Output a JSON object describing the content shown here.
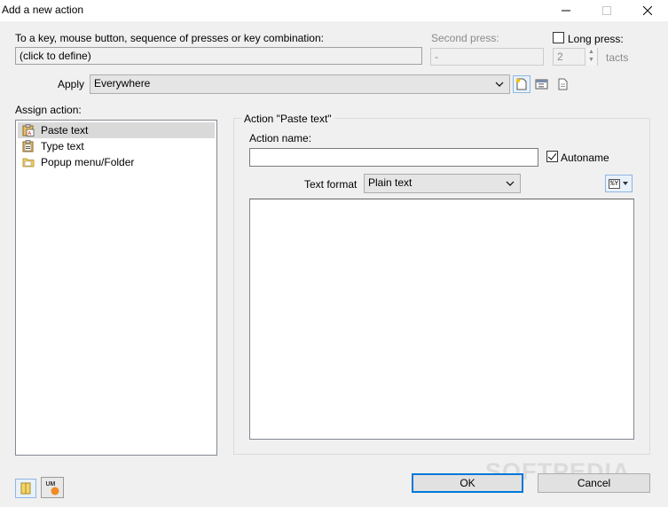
{
  "window": {
    "title": "Add a new action"
  },
  "trigger": {
    "label": "To a key, mouse button, sequence of presses or key combination:",
    "value": "(click to define)",
    "second_press_label": "Second press:",
    "second_press_value": "-",
    "long_press_label": "Long press:",
    "long_press_checked": false,
    "tacts_value": "2",
    "tacts_label": "tacts"
  },
  "apply": {
    "label": "Apply",
    "selected": "Everywhere"
  },
  "assign": {
    "label": "Assign action:",
    "items": [
      {
        "label": "Paste text",
        "icon": "paste-text-icon",
        "selected": true
      },
      {
        "label": "Type text",
        "icon": "type-text-icon",
        "selected": false
      },
      {
        "label": "Popup menu/Folder",
        "icon": "folder-icon",
        "selected": false
      }
    ]
  },
  "action_panel": {
    "group_title": "Action \"Paste text\"",
    "name_label": "Action name:",
    "name_value": "",
    "autoname_label": "Autoname",
    "autoname_checked": true,
    "text_format_label": "Text format",
    "text_format_selected": "Plain text",
    "macro_button_icon": "%Y",
    "text_value": ""
  },
  "buttons": {
    "ok": "OK",
    "cancel": "Cancel"
  },
  "bottom_icons": [
    "notebook-icon",
    "um-logo-icon"
  ],
  "watermark": "SOFTPEDIA"
}
